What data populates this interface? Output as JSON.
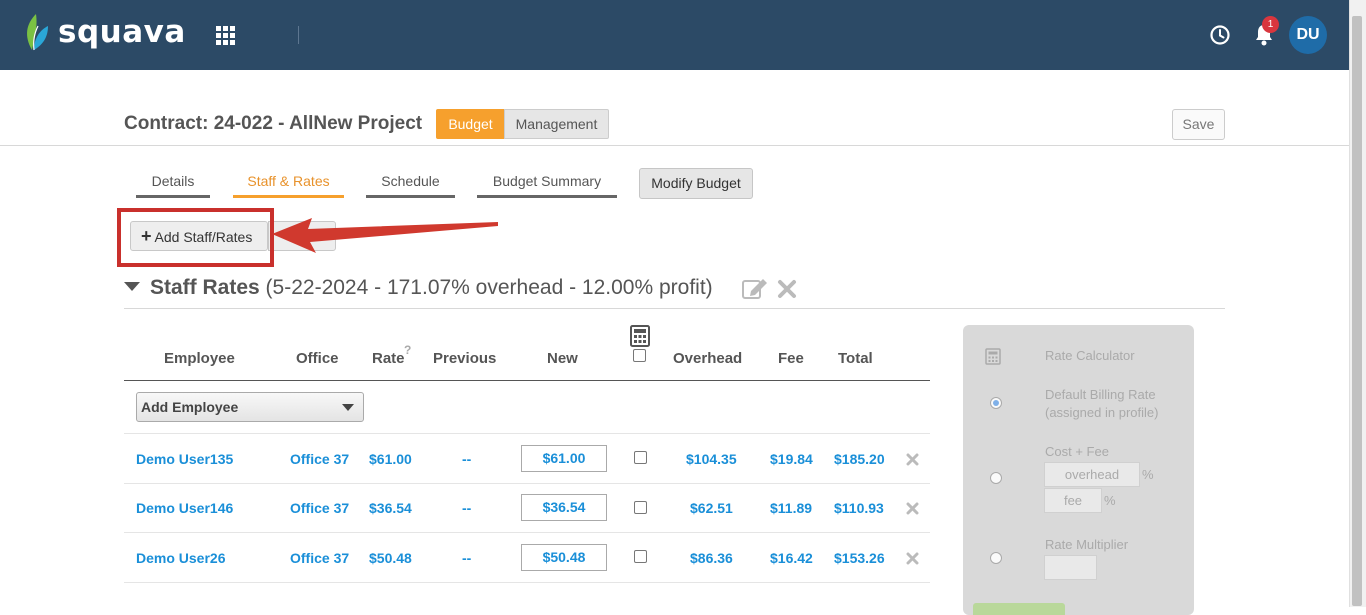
{
  "header": {
    "logo_text": "squava",
    "notification_count": "1",
    "avatar_initials": "DU"
  },
  "contract": {
    "title": "Contract: 24-022 - AllNew Project",
    "mode_budget": "Budget",
    "mode_management": "Management",
    "save_label": "Save"
  },
  "tabs": [
    {
      "label": "Details"
    },
    {
      "label": "Staff & Rates"
    },
    {
      "label": "Schedule"
    },
    {
      "label": "Budget Summary"
    }
  ],
  "modify_budget_label": "Modify Budget",
  "add_staff_label": "Add Staff/Rates",
  "section": {
    "title": "Staff Rates",
    "subtitle": "(5-22-2024 - 171.07% overhead - 12.00% profit)"
  },
  "table": {
    "headers": {
      "employee": "Employee",
      "office": "Office",
      "rate": "Rate",
      "rate_help": "?",
      "previous": "Previous",
      "new": "New",
      "overhead": "Overhead",
      "fee": "Fee",
      "total": "Total"
    },
    "add_employee_label": "Add Employee",
    "rows": [
      {
        "employee": "Demo User135",
        "office": "Office 37",
        "rate": "$61.00",
        "previous": "--",
        "new": "$61.00",
        "overhead": "$104.35",
        "fee": "$19.84",
        "total": "$185.20"
      },
      {
        "employee": "Demo User146",
        "office": "Office 37",
        "rate": "$36.54",
        "previous": "--",
        "new": "$36.54",
        "overhead": "$62.51",
        "fee": "$11.89",
        "total": "$110.93"
      },
      {
        "employee": "Demo User26",
        "office": "Office 37",
        "rate": "$50.48",
        "previous": "--",
        "new": "$50.48",
        "overhead": "$86.36",
        "fee": "$16.42",
        "total": "$153.26"
      }
    ]
  },
  "rate_calculator": {
    "title": "Rate Calculator",
    "default_billing": "Default Billing Rate",
    "default_billing_note": "(assigned in profile)",
    "cost_fee": "Cost + Fee",
    "overhead_placeholder": "overhead",
    "fee_placeholder": "fee",
    "percent": "%",
    "rate_multiplier": "Rate Multiplier"
  },
  "colors": {
    "topbar": "#2c4a66",
    "accent_orange": "#f6a02d",
    "link_blue": "#1a8fd8",
    "highlight_red": "#c9302c"
  }
}
